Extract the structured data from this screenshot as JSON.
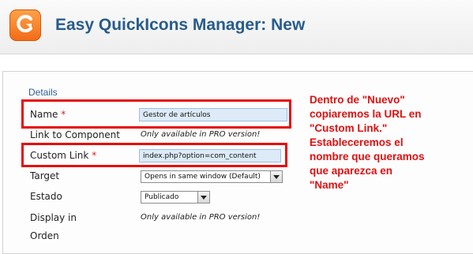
{
  "header": {
    "title": "Easy QuickIcons Manager: New",
    "logo_icon": "easy-quickicons-logo-icon"
  },
  "form": {
    "legend": "Details",
    "required_marker": "*",
    "name": {
      "label": "Name",
      "value": "Gestor de artículos"
    },
    "link_to_component": {
      "label": "Link to Component",
      "note": "Only available in PRO version!"
    },
    "custom_link": {
      "label": "Custom Link",
      "value": "index.php?option=com_content"
    },
    "target": {
      "label": "Target",
      "selected": "Opens in same window (Default)"
    },
    "estado": {
      "label": "Estado",
      "selected": "Publicado"
    },
    "display_in": {
      "label": "Display in",
      "note": "Only available in PRO version!"
    },
    "orden": {
      "label": "Orden"
    }
  },
  "annotation": {
    "lines": [
      "Dentro de \"Nuevo\"",
      "copiaremos la URL en",
      "\"Custom Link.\"",
      "Estableceremos el",
      "nombre que queramos",
      "que aparezca en",
      "\"Name\""
    ]
  },
  "colors": {
    "title": "#275c8c",
    "logo": "#f26a16",
    "input_bg": "#dcebf7",
    "annotation_red": "#e01010"
  }
}
